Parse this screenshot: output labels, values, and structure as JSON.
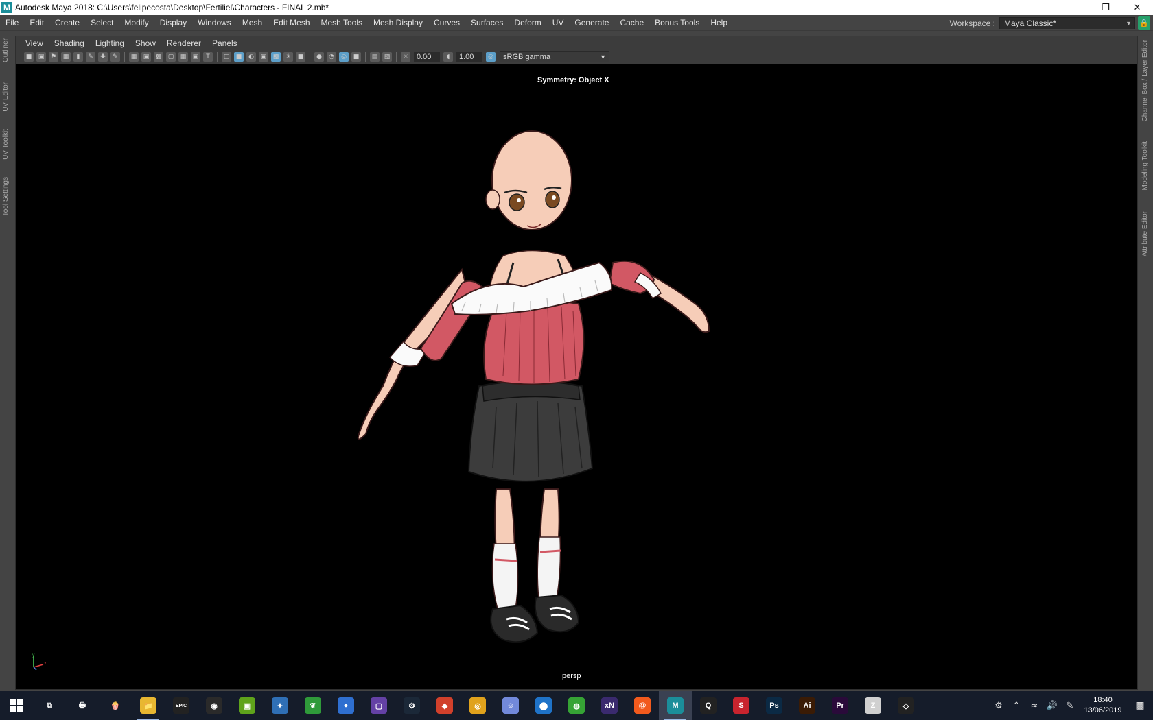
{
  "window": {
    "title": "Autodesk Maya 2018: C:\\Users\\felipecosta\\Desktop\\Fertiliel\\Characters - FINAL 2.mb*",
    "controls": [
      "minimize",
      "restore",
      "close"
    ]
  },
  "main_menu": [
    "File",
    "Edit",
    "Create",
    "Select",
    "Modify",
    "Display",
    "Windows",
    "Mesh",
    "Edit Mesh",
    "Mesh Tools",
    "Mesh Display",
    "Curves",
    "Surfaces",
    "Deform",
    "UV",
    "Generate",
    "Cache",
    "Bonus Tools",
    "Help"
  ],
  "workspace": {
    "label": "Workspace :",
    "value": "Maya Classic*"
  },
  "left_tabs": [
    "Outliner",
    "UV Editor",
    "UV Toolkit",
    "Tool Settings"
  ],
  "right_tabs": [
    "Channel Box / Layer Editor",
    "Modeling Toolkit",
    "Attribute Editor"
  ],
  "panel_menu": [
    "View",
    "Shading",
    "Lighting",
    "Show",
    "Renderer",
    "Panels"
  ],
  "panel_toolbar": {
    "exposure": "0.00",
    "gamma": "1.00",
    "color_space": "sRGB gamma"
  },
  "viewport": {
    "symmetry": "Symmetry: Object X",
    "camera": "persp",
    "background": "#000000"
  },
  "taskbar": {
    "apps": [
      {
        "name": "task-view",
        "label": "⧉",
        "color": "transparent"
      },
      {
        "name": "printer",
        "label": "🖶",
        "color": "transparent"
      },
      {
        "name": "popcorn",
        "label": "🍿",
        "color": "transparent"
      },
      {
        "name": "file-explorer",
        "label": "📁",
        "color": "#e8b731"
      },
      {
        "name": "epic-games",
        "label": "EPIC",
        "color": "#222222"
      },
      {
        "name": "obs",
        "label": "◉",
        "color": "#2a2a2a"
      },
      {
        "name": "nvidia",
        "label": "▣",
        "color": "#5fa31b"
      },
      {
        "name": "wing-app",
        "label": "✦",
        "color": "#2f6fb5"
      },
      {
        "name": "dragon-app",
        "label": "❦",
        "color": "#2f9a3a"
      },
      {
        "name": "blue-app",
        "label": "●",
        "color": "#2f6fd0"
      },
      {
        "name": "twitch",
        "label": "▢",
        "color": "#6441a5"
      },
      {
        "name": "steam",
        "label": "⚙",
        "color": "#1b2838"
      },
      {
        "name": "strip-app",
        "label": "◆",
        "color": "#d1402b"
      },
      {
        "name": "chrome",
        "label": "◎",
        "color": "#e0a21c"
      },
      {
        "name": "discord",
        "label": "☺",
        "color": "#7289da"
      },
      {
        "name": "maps",
        "label": "⬤",
        "color": "#1f73c8"
      },
      {
        "name": "green-app",
        "label": "◍",
        "color": "#36a335"
      },
      {
        "name": "xnormal",
        "label": "xN",
        "color": "#3a2a6e"
      },
      {
        "name": "houdini",
        "label": "@",
        "color": "#f25a1d"
      },
      {
        "name": "maya",
        "label": "M",
        "color": "#1b8e9a"
      },
      {
        "name": "q-app",
        "label": "Q",
        "color": "#222222"
      },
      {
        "name": "substance",
        "label": "S",
        "color": "#c8242e"
      },
      {
        "name": "photoshop",
        "label": "Ps",
        "color": "#0b2a45"
      },
      {
        "name": "illustrator",
        "label": "Ai",
        "color": "#3a1b05"
      },
      {
        "name": "premiere",
        "label": "Pr",
        "color": "#2a0a3a"
      },
      {
        "name": "zbrush",
        "label": "Z",
        "color": "#d0d0d0"
      },
      {
        "name": "unity",
        "label": "◇",
        "color": "#222222"
      }
    ],
    "time": "18:40",
    "date": "13/06/2019"
  }
}
